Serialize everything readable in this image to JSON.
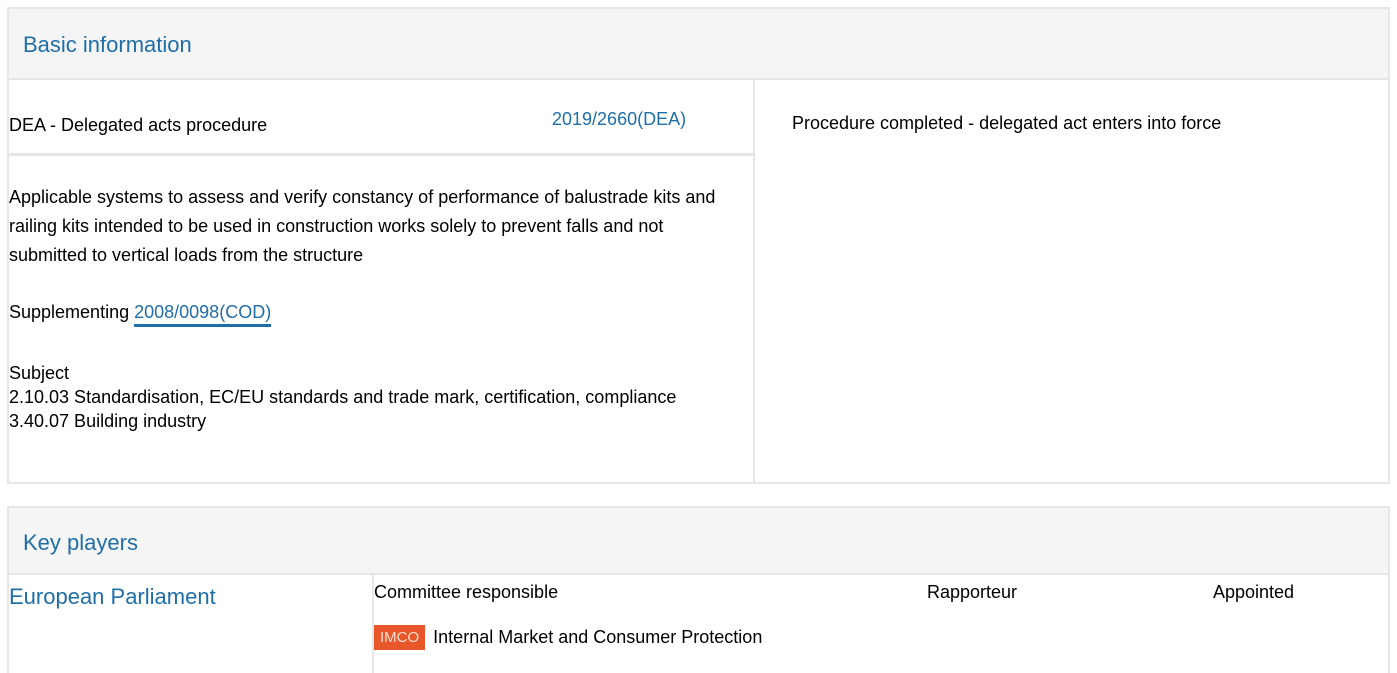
{
  "basic_information": {
    "title": "Basic information",
    "procedure_type": "DEA - Delegated acts procedure",
    "procedure_reference": "2019/2660(DEA)",
    "status": "Procedure completed - delegated act enters into force",
    "description": "Applicable systems to assess and verify constancy of performance of balustrade kits and railing kits intended to be used in construction works solely to prevent falls and not submitted to vertical loads from the structure",
    "supplementing_label": "Supplementing",
    "supplementing_ref": "2008/0098(COD)",
    "subject_label": "Subject",
    "subjects": [
      "2.10.03 Standardisation, EC/EU standards and trade mark, certification, compliance",
      "3.40.07 Building industry"
    ]
  },
  "key_players": {
    "title": "Key players",
    "institution": "European Parliament",
    "columns": {
      "committee": "Committee responsible",
      "rapporteur": "Rapporteur",
      "appointed": "Appointed"
    },
    "committee": {
      "code": "IMCO",
      "name": "Internal Market and Consumer Protection",
      "badge_color": "#e8572a"
    }
  },
  "colors": {
    "link": "#1f6ea8",
    "header_bg": "#f5f5f5",
    "border": "#e6e6e6"
  }
}
